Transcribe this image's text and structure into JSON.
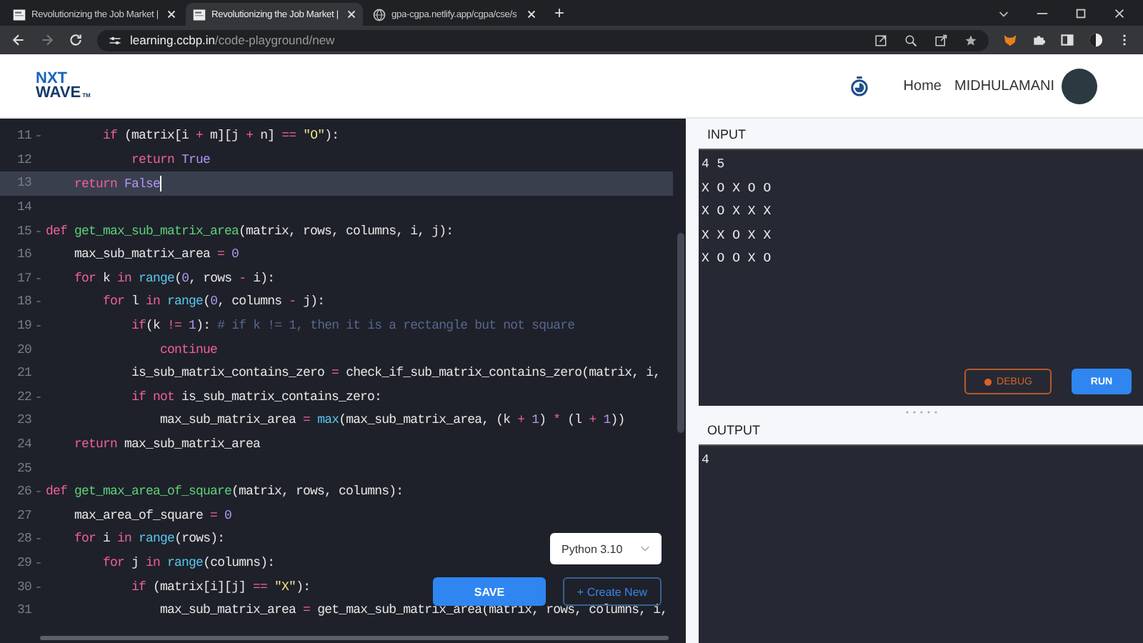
{
  "browser": {
    "tabs": [
      {
        "title": "Revolutionizing the Job Market |",
        "selected": false,
        "kind": "page"
      },
      {
        "title": "Revolutionizing the Job Market |",
        "selected": true,
        "kind": "page"
      },
      {
        "title": "gpa-cgpa.netlify.app/cgpa/cse/s",
        "selected": false,
        "kind": "globe"
      }
    ],
    "new_tab": "+",
    "address": {
      "host": "learning.ccbp.in",
      "path": "/code-playground/new"
    }
  },
  "header": {
    "logo": {
      "line_1": "NXT",
      "line_2": "WAVE",
      "mark": "TM"
    },
    "nav": [
      "Home"
    ],
    "user": "MIDHULAMANI"
  },
  "editor": {
    "lines": [
      {
        "number": "11",
        "foldable": true,
        "active": false,
        "tokens": [
          {
            "kind": "kw",
            "text": "        if"
          },
          {
            "kind": "plain",
            "text": " (matrix[i "
          },
          {
            "kind": "op",
            "text": "+"
          },
          {
            "kind": "plain",
            "text": " m][j "
          },
          {
            "kind": "op",
            "text": "+"
          },
          {
            "kind": "plain",
            "text": " n] "
          },
          {
            "kind": "op",
            "text": "=="
          },
          {
            "kind": "str",
            "text": " \"O\""
          },
          {
            "kind": "plain",
            "text": "):"
          }
        ]
      },
      {
        "number": "12",
        "foldable": false,
        "active": false,
        "tokens": [
          {
            "kind": "kw",
            "text": "            return"
          },
          {
            "kind": "bool",
            "text": " True"
          }
        ]
      },
      {
        "number": "13",
        "foldable": false,
        "active": true,
        "tokens": [
          {
            "kind": "kw",
            "text": "    return"
          },
          {
            "kind": "bool",
            "text": " False"
          }
        ]
      },
      {
        "number": "14",
        "foldable": false,
        "active": false
      },
      {
        "number": "15",
        "foldable": true,
        "active": false,
        "tokens": [
          {
            "kind": "kw",
            "text": "def"
          },
          {
            "kind": "fn",
            "text": " get_max_sub_matrix_area"
          },
          {
            "kind": "plain",
            "text": "(matrix, rows, columns, i, j):"
          }
        ]
      },
      {
        "number": "16",
        "foldable": false,
        "active": false,
        "tokens": [
          {
            "kind": "plain",
            "text": "    max_sub_matrix_area "
          },
          {
            "kind": "op",
            "text": "="
          },
          {
            "kind": "num",
            "text": " 0"
          }
        ]
      },
      {
        "number": "17",
        "foldable": true,
        "active": false,
        "tokens": [
          {
            "kind": "kw",
            "text": "    for"
          },
          {
            "kind": "plain",
            "text": " k "
          },
          {
            "kind": "kw",
            "text": "in"
          },
          {
            "kind": "bi",
            "text": " range"
          },
          {
            "kind": "plain",
            "text": "("
          },
          {
            "kind": "num",
            "text": "0"
          },
          {
            "kind": "plain",
            "text": ", rows "
          },
          {
            "kind": "op",
            "text": "-"
          },
          {
            "kind": "plain",
            "text": " i):"
          }
        ]
      },
      {
        "number": "18",
        "foldable": true,
        "active": false,
        "tokens": [
          {
            "kind": "kw",
            "text": "        for"
          },
          {
            "kind": "plain",
            "text": " l "
          },
          {
            "kind": "kw",
            "text": "in"
          },
          {
            "kind": "bi",
            "text": " range"
          },
          {
            "kind": "plain",
            "text": "("
          },
          {
            "kind": "num",
            "text": "0"
          },
          {
            "kind": "plain",
            "text": ", columns "
          },
          {
            "kind": "op",
            "text": "-"
          },
          {
            "kind": "plain",
            "text": " j):"
          }
        ]
      },
      {
        "number": "19",
        "foldable": true,
        "active": false,
        "tokens": [
          {
            "kind": "kw",
            "text": "            if"
          },
          {
            "kind": "plain",
            "text": "(k "
          },
          {
            "kind": "op",
            "text": "!="
          },
          {
            "kind": "num",
            "text": " 1"
          },
          {
            "kind": "plain",
            "text": "): "
          },
          {
            "kind": "cm",
            "text": "# if k != 1, then it is a rectangle but not square"
          }
        ]
      },
      {
        "number": "20",
        "foldable": false,
        "active": false,
        "tokens": [
          {
            "kind": "kw",
            "text": "                continue"
          }
        ]
      },
      {
        "number": "21",
        "foldable": false,
        "active": false,
        "tokens": [
          {
            "kind": "plain",
            "text": "            is_sub_matrix_contains_zero "
          },
          {
            "kind": "op",
            "text": "="
          },
          {
            "kind": "plain",
            "text": " check_if_sub_matrix_contains_zero(matrix, i,"
          }
        ]
      },
      {
        "number": "22",
        "foldable": true,
        "active": false,
        "tokens": [
          {
            "kind": "kw",
            "text": "            if"
          },
          {
            "kind": "kw",
            "text": " not"
          },
          {
            "kind": "plain",
            "text": " is_sub_matrix_contains_zero:"
          }
        ]
      },
      {
        "number": "23",
        "foldable": false,
        "active": false,
        "tokens": [
          {
            "kind": "plain",
            "text": "                max_sub_matrix_area "
          },
          {
            "kind": "op",
            "text": "="
          },
          {
            "kind": "bi",
            "text": " max"
          },
          {
            "kind": "plain",
            "text": "(max_sub_matrix_area, (k "
          },
          {
            "kind": "op",
            "text": "+"
          },
          {
            "kind": "num",
            "text": " 1"
          },
          {
            "kind": "plain",
            "text": ") "
          },
          {
            "kind": "op",
            "text": "*"
          },
          {
            "kind": "plain",
            "text": " (l "
          },
          {
            "kind": "op",
            "text": "+"
          },
          {
            "kind": "num",
            "text": " 1"
          },
          {
            "kind": "plain",
            "text": "))"
          }
        ]
      },
      {
        "number": "24",
        "foldable": false,
        "active": false,
        "tokens": [
          {
            "kind": "kw",
            "text": "    return"
          },
          {
            "kind": "plain",
            "text": " max_sub_matrix_area"
          }
        ]
      },
      {
        "number": "25",
        "foldable": false,
        "active": false
      },
      {
        "number": "26",
        "foldable": true,
        "active": false,
        "tokens": [
          {
            "kind": "kw",
            "text": "def"
          },
          {
            "kind": "fn",
            "text": " get_max_area_of_square"
          },
          {
            "kind": "plain",
            "text": "(matrix, rows, columns):"
          }
        ]
      },
      {
        "number": "27",
        "foldable": false,
        "active": false,
        "tokens": [
          {
            "kind": "plain",
            "text": "    max_area_of_square "
          },
          {
            "kind": "op",
            "text": "="
          },
          {
            "kind": "num",
            "text": " 0"
          }
        ]
      },
      {
        "number": "28",
        "foldable": true,
        "active": false,
        "tokens": [
          {
            "kind": "kw",
            "text": "    for"
          },
          {
            "kind": "plain",
            "text": " i "
          },
          {
            "kind": "kw",
            "text": "in"
          },
          {
            "kind": "bi",
            "text": " range"
          },
          {
            "kind": "plain",
            "text": "(rows):"
          }
        ]
      },
      {
        "number": "29",
        "foldable": true,
        "active": false,
        "tokens": [
          {
            "kind": "kw",
            "text": "        for"
          },
          {
            "kind": "plain",
            "text": " j "
          },
          {
            "kind": "kw",
            "text": "in"
          },
          {
            "kind": "bi",
            "text": " range"
          },
          {
            "kind": "plain",
            "text": "(columns):"
          }
        ]
      },
      {
        "number": "30",
        "foldable": true,
        "active": false,
        "tokens": [
          {
            "kind": "kw",
            "text": "            if"
          },
          {
            "kind": "plain",
            "text": " (matrix[i][j] "
          },
          {
            "kind": "op",
            "text": "=="
          },
          {
            "kind": "str",
            "text": " \"X\""
          },
          {
            "kind": "plain",
            "text": "):"
          }
        ]
      },
      {
        "number": "31",
        "foldable": false,
        "active": false,
        "tokens": [
          {
            "kind": "plain",
            "text": "                max_sub_matrix_area "
          },
          {
            "kind": "op",
            "text": "="
          },
          {
            "kind": "plain",
            "text": " get_max_sub_matrix_area(matrix, rows, columns, i,"
          }
        ]
      }
    ],
    "language": "Python 3.10",
    "save": "SAVE",
    "create": "+ Create New"
  },
  "input": {
    "title": "INPUT",
    "lines": [
      "4 5",
      "X O X O O",
      "X O X X X",
      "X X O X X",
      "X O O X O"
    ],
    "debug": "DEBUG",
    "run": "RUN"
  },
  "output": {
    "title": "OUTPUT",
    "lines": [
      "4"
    ]
  }
}
